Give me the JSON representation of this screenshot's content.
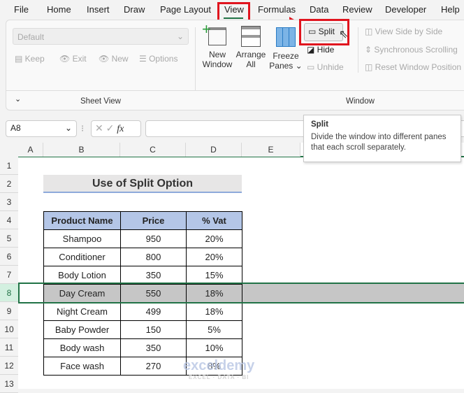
{
  "menu": [
    "File",
    "Home",
    "Insert",
    "Draw",
    "Page Layout",
    "View",
    "Formulas",
    "Data",
    "Review",
    "Developer",
    "Help"
  ],
  "ribbon": {
    "sheet_view": {
      "dropdown": "Default",
      "keep": "Keep",
      "exit": "Exit",
      "new": "New",
      "options": "Options",
      "group": "Sheet View"
    },
    "window": {
      "new_window": [
        "New",
        "Window"
      ],
      "arrange_all": [
        "Arrange",
        "All"
      ],
      "freeze_panes": [
        "Freeze",
        "Panes ⌄"
      ],
      "split": "Split",
      "hide": "Hide",
      "unhide": "Unhide",
      "side_by_side": "View Side by Side",
      "sync_scroll": "Synchronous Scrolling",
      "reset_pos": "Reset Window Position",
      "group": "Window"
    },
    "collapse": "⌄"
  },
  "tooltip": {
    "title": "Split",
    "body": "Divide the window into different panes that each scroll separately."
  },
  "formula_bar": {
    "name_box": "A8",
    "value": "",
    "fx": "fx"
  },
  "columns": [
    "A",
    "B",
    "C",
    "D",
    "E"
  ],
  "rows": [
    "1",
    "2",
    "3",
    "4",
    "5",
    "6",
    "7",
    "8",
    "9",
    "10",
    "11",
    "12",
    "13"
  ],
  "sheet": {
    "title": "Use of Split Option",
    "headers": [
      "Product Name",
      "Price",
      "% Vat"
    ],
    "data": [
      [
        "Shampoo",
        "950",
        "20%"
      ],
      [
        "Conditioner",
        "800",
        "20%"
      ],
      [
        "Body Lotion",
        "350",
        "15%"
      ],
      [
        "Day Cream",
        "550",
        "18%"
      ],
      [
        "Night Cream",
        "499",
        "18%"
      ],
      [
        "Baby Powder",
        "150",
        "5%"
      ],
      [
        "Body wash",
        "350",
        "10%"
      ],
      [
        "Face wash",
        "270",
        "8%"
      ]
    ]
  },
  "watermark": {
    "name": "exceldemy",
    "tag": "EXCEL · DATA · BI"
  },
  "colors": {
    "accent": "#217346",
    "highlight": "#e0141e",
    "header_fill": "#b4c6e7",
    "selected": "#c6c6c6"
  }
}
